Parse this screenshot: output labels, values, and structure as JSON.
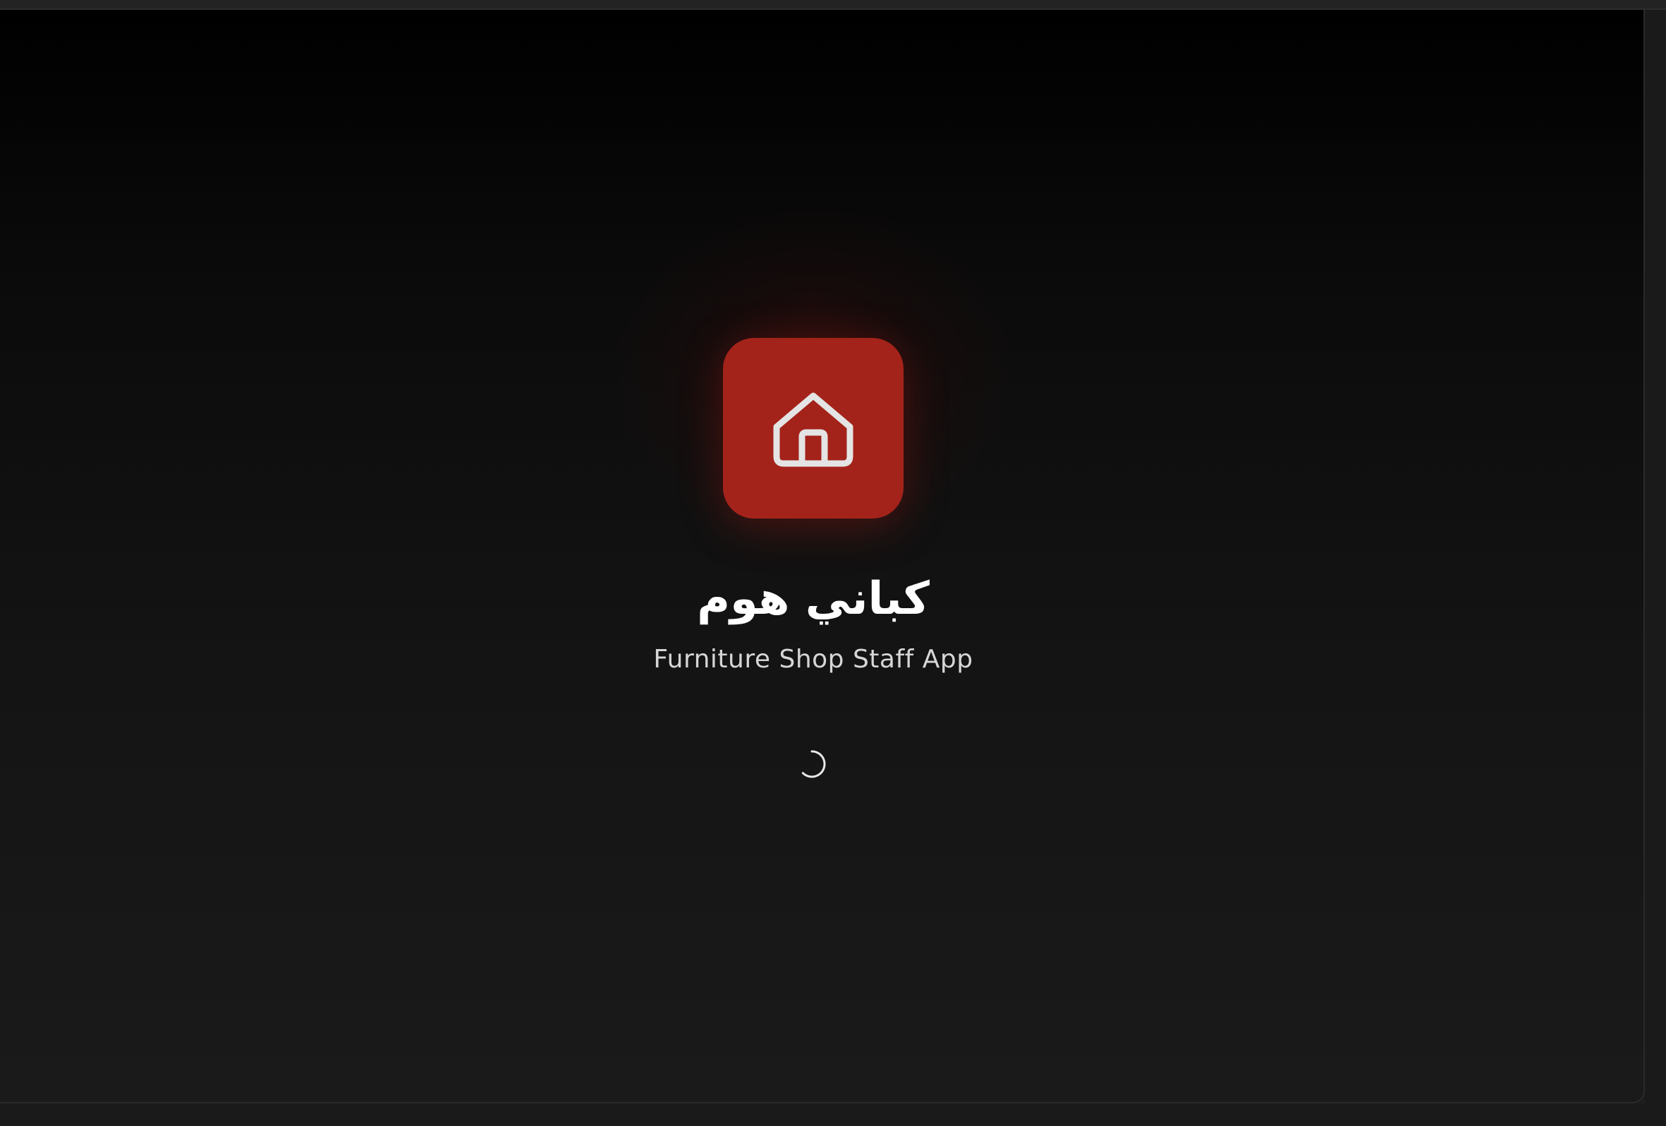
{
  "splash": {
    "app_name": "كباني هوم",
    "subtitle": "Furniture Shop Staff App",
    "logo_icon": "home-icon",
    "loading_indicator": "spinner-icon"
  },
  "colors": {
    "accent": "#a3231a",
    "background_top": "#000000",
    "background_bottom": "#1a1a1a",
    "title_text": "#ffffff",
    "subtitle_text": "#d6d6d6"
  }
}
